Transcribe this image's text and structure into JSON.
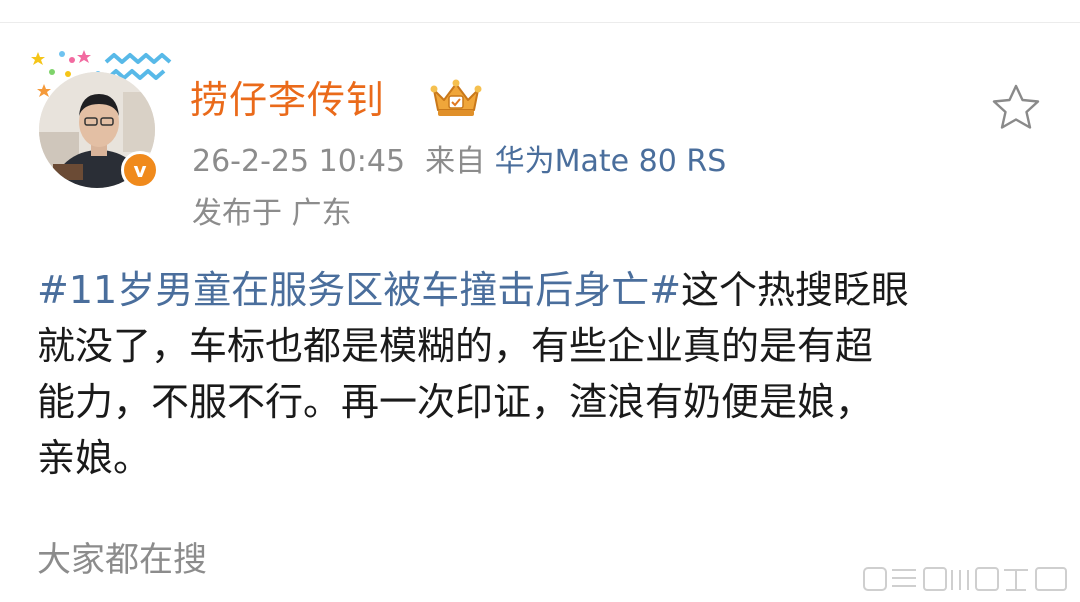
{
  "post": {
    "author": "捞仔李传钊",
    "timestamp": "26-2-25 10:45",
    "source_prefix": "来自",
    "device": "华为Mate 80 RS",
    "location": "发布于 广东",
    "hashtag": "#11岁男童在服务区被车撞击后身亡#",
    "line1_rest": "这个热搜眨眼",
    "line2": "就没了，车标也都是模糊的，有些企业真的是有超",
    "line3": "能力，不服不行。再一次印证，渣浪有奶便是娘，",
    "line4": "亲娘。"
  },
  "footer": {
    "everyone_search": "大家都在搜"
  },
  "icons": {
    "verified": "verified-v-icon",
    "crown": "crown-badge-icon",
    "favorite": "star-outline-icon"
  },
  "colors": {
    "username": "#ea6a1a",
    "link": "#4a6e9c",
    "verified_badge": "#f08a1c",
    "meta_text": "#8c8c8c",
    "body_text": "#1a1a1a"
  }
}
